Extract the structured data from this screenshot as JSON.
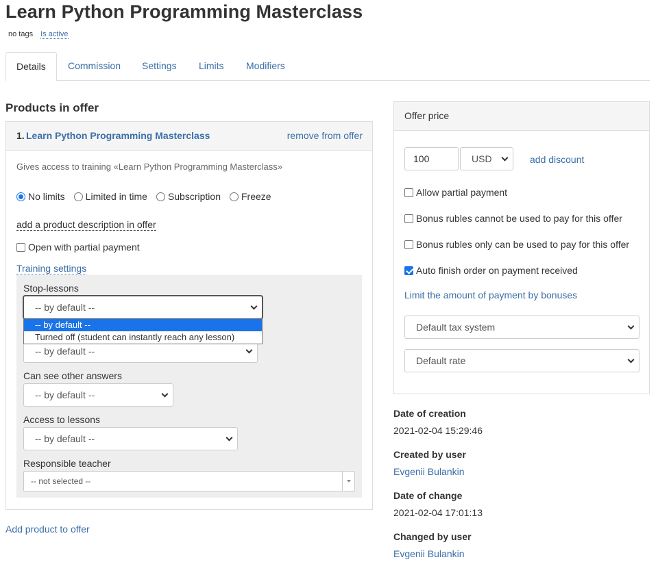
{
  "page": {
    "title": "Learn Python Programming Masterclass",
    "tags": "no tags",
    "status": "Is active"
  },
  "tabs": [
    "Details",
    "Commission",
    "Settings",
    "Limits",
    "Modifiers"
  ],
  "products": {
    "section_title": "Products in offer",
    "item": {
      "number": "1.",
      "name": "Learn Python Programming Masterclass",
      "remove_label": "remove from offer",
      "gives_access": "Gives access to training «Learn Python Programming Masterclass»",
      "access_options": [
        "No limits",
        "Limited in time",
        "Subscription",
        "Freeze"
      ],
      "selected_access": "No limits",
      "add_description": "add a product description in offer",
      "open_partial_label": "Open with partial payment",
      "open_partial_checked": false,
      "training_settings_link": "Training settings",
      "training": {
        "stop_lessons_label": "Stop-lessons",
        "stop_lessons_value": "-- by default --",
        "dropdown_options": [
          "-- by default --",
          "Turned off (student can instantly reach any lesson)"
        ],
        "hidden_select_value": "-- by default --",
        "other_answers_label": "Can see other answers",
        "other_answers_value": "-- by default --",
        "access_lessons_label": "Access to lessons",
        "access_lessons_value": "-- by default --",
        "teacher_label": "Responsible teacher",
        "teacher_value": "-- not selected --"
      }
    },
    "add_product_link": "Add product to offer"
  },
  "offer_price": {
    "header": "Offer price",
    "amount": "100",
    "currency": "USD",
    "add_discount": "add discount",
    "options": [
      {
        "label": "Allow partial payment",
        "checked": false
      },
      {
        "label": "Bonus rubles cannot be used to pay for this offer",
        "checked": false
      },
      {
        "label": "Bonus rubles only can be used to pay for this offer",
        "checked": false
      },
      {
        "label": "Auto finish order on payment received",
        "checked": true
      }
    ],
    "limit_bonuses_link": "Limit the amount of payment by bonuses",
    "tax_system": "Default tax system",
    "rate": "Default rate"
  },
  "meta": {
    "created_label": "Date of creation",
    "created_value": "2021-02-04 15:29:46",
    "created_by_label": "Created by user",
    "created_by_value": "Evgenii Bulankin",
    "changed_label": "Date of change",
    "changed_value": "2021-02-04 17:01:13",
    "changed_by_label": "Changed by user",
    "changed_by_value": "Evgenii Bulankin"
  },
  "colors": {
    "link": "#3a6fa8",
    "accent": "#1a73e8",
    "panel_header": "#f5f5f5",
    "training_box": "#eeeeee"
  }
}
